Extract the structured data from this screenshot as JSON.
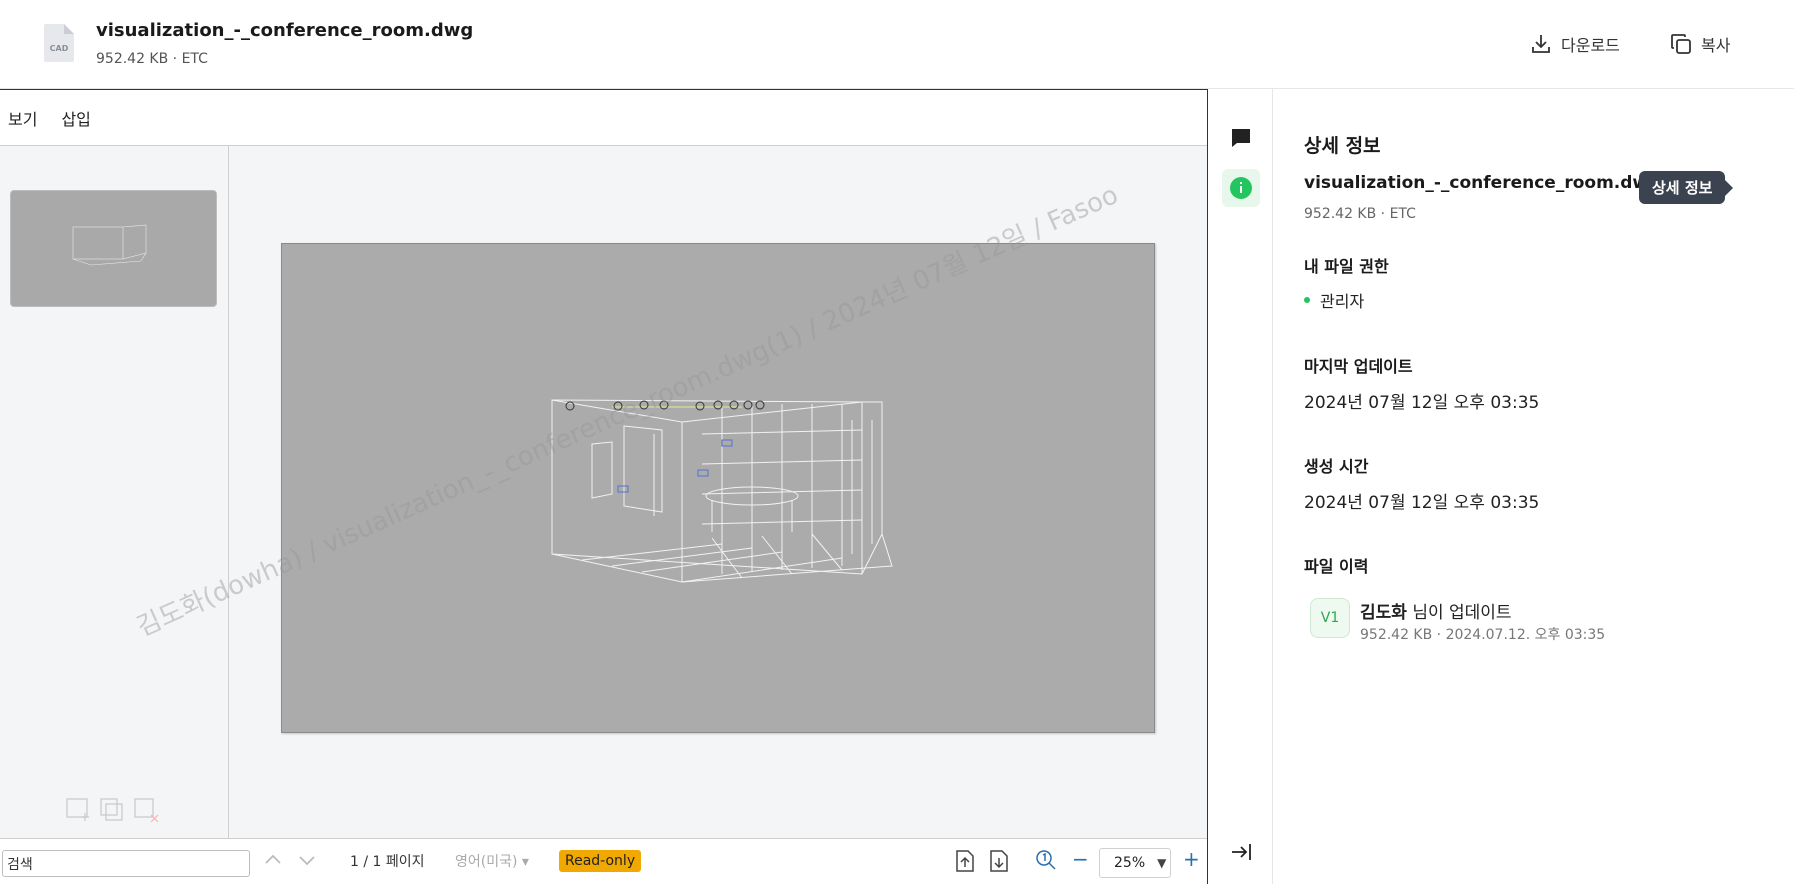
{
  "header": {
    "file_icon_label": "CAD",
    "title": "visualization_-_conference_room.dwg",
    "meta": "952.42 KB · ETC",
    "download_label": "다운로드",
    "copy_label": "복사"
  },
  "viewer": {
    "menu": [
      "보기",
      "삽입"
    ],
    "watermark": "김도화(dowha) / visualization_-_conference_room.dwg(1) / 2024년 07월 12일 / Fasoo",
    "status": {
      "search_value": "검색",
      "page_info": "1 / 1 페이지",
      "language": "영어(미국)",
      "readonly": "Read-only",
      "zoom": "25%"
    }
  },
  "panel": {
    "title": "상세 정보",
    "file_name": "visualization_-_conference_room.dwg",
    "file_meta": "952.42 KB · ETC",
    "tooltip": "상세 정보",
    "permission_title": "내 파일 권한",
    "permission_value": "관리자",
    "last_update_title": "마지막 업데이트",
    "last_update_value": "2024년 07월 12일 오후 03:35",
    "created_title": "생성 시간",
    "created_value": "2024년 07월 12일 오후 03:35",
    "history_title": "파일 이력",
    "history": {
      "version": "V1",
      "user": "김도화",
      "action": " 님이 업데이트",
      "meta": "952.42 KB · 2024.07.12. 오후 03:35"
    }
  },
  "colors": {
    "accent_green": "#22c55e",
    "readonly_bg": "#f1a800",
    "tooltip_bg": "#3b4250"
  }
}
